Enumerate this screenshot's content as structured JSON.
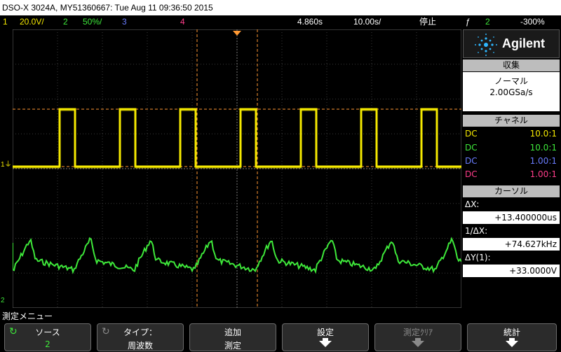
{
  "title": "DSO-X 3024A, MY51360667: Tue Aug 11 09:36:50 2015",
  "status": {
    "ch1_num": "1",
    "ch1_scale": "20.0V/",
    "ch2_num": "2",
    "ch2_scale": "50%/",
    "ch3_num": "3",
    "ch4_num": "4",
    "time_pos": "4.860s",
    "time_scale": "10.00s/",
    "run_state": "停止",
    "trig_icon": "ƒ",
    "trig_ch": "2",
    "trig_level": "-300%"
  },
  "markers": {
    "ch1": "1",
    "ch2": "2"
  },
  "panel": {
    "brand": "Agilent",
    "acq_title": "収集",
    "acq_mode": "ノーマル",
    "acq_rate": "2.00GSa/s",
    "chan_title": "チャネル",
    "channels": [
      {
        "coupling": "DC",
        "probe": "10.0:1",
        "color": "#f5e900"
      },
      {
        "coupling": "DC",
        "probe": "10.0:1",
        "color": "#3ee83a"
      },
      {
        "coupling": "DC",
        "probe": "1.00:1",
        "color": "#6a7dff"
      },
      {
        "coupling": "DC",
        "probe": "1.00:1",
        "color": "#ff3d8a"
      }
    ],
    "cursor_title": "カーソル",
    "dx_label": "ΔX:",
    "dx_value": "+13.400000us",
    "inv_dx_label": "1/ΔX:",
    "inv_dx_value": "+74.627kHz",
    "dy_label": "ΔY(1):",
    "dy_value": "+33.0000V"
  },
  "menu_title": "測定メニュー",
  "softkeys": [
    {
      "line1": "ソース",
      "line2": "2"
    },
    {
      "line1": "タイプ：",
      "line2": "周波数"
    },
    {
      "line1": "追加",
      "line2": "測定"
    },
    {
      "line1": "設定",
      "line2": ""
    },
    {
      "line1": "測定ｸﾘｱ",
      "line2": ""
    },
    {
      "line1": "統計",
      "line2": ""
    }
  ],
  "colors": {
    "ch1": "#f5e900",
    "ch2": "#3ee83a",
    "ch3": "#6a7dff",
    "ch4": "#ff3d8a",
    "cursor": "#ff9933"
  },
  "icons": {
    "source": "rotate-knob-icon",
    "type": "rotate-knob-icon",
    "settings": "arrow-down-icon",
    "stats": "arrow-down-icon"
  }
}
